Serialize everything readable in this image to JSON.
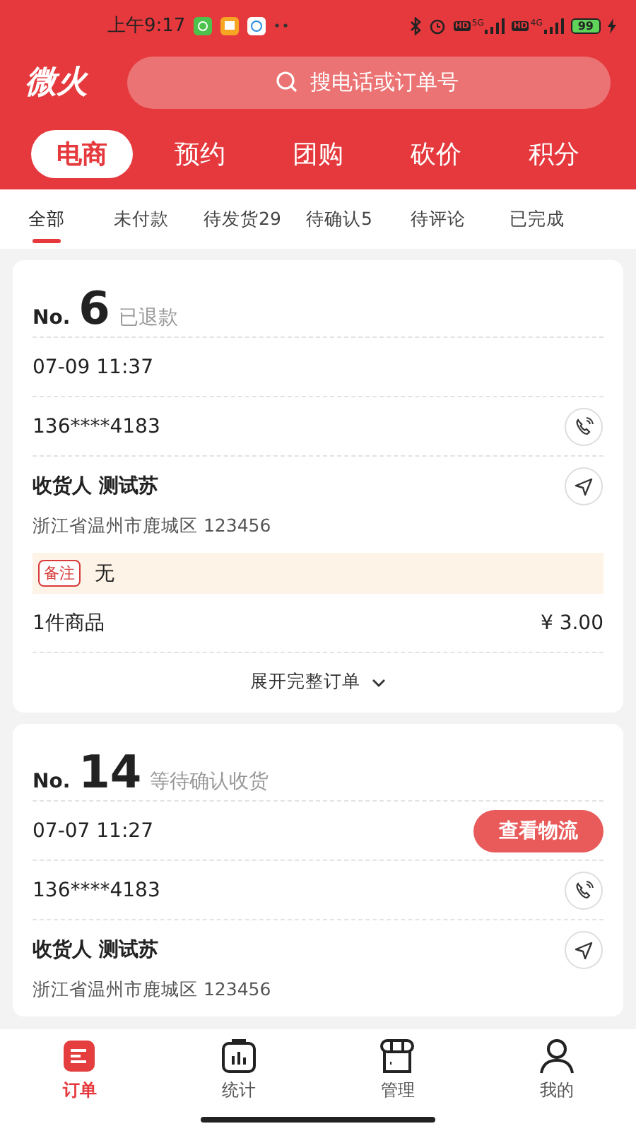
{
  "status_bar": {
    "time": "上午9:17",
    "signals": [
      {
        "badge": "HD",
        "network": "5G"
      },
      {
        "badge": "HD",
        "network": "4G"
      }
    ],
    "battery": "99"
  },
  "header": {
    "logo": "微火",
    "search": {
      "placeholder": "搜电话或订单号"
    }
  },
  "business_tabs": [
    {
      "label": "电商",
      "selected": true
    },
    {
      "label": "预约",
      "selected": false
    },
    {
      "label": "团购",
      "selected": false
    },
    {
      "label": "砍价",
      "selected": false
    },
    {
      "label": "积分",
      "selected": false
    }
  ],
  "status_tabs": [
    {
      "label": "全部",
      "selected": true
    },
    {
      "label": "未付款",
      "selected": false
    },
    {
      "label": "待发货29",
      "selected": false
    },
    {
      "label": "待确认5",
      "selected": false
    },
    {
      "label": "待评论",
      "selected": false
    },
    {
      "label": "已完成",
      "selected": false
    }
  ],
  "orders": [
    {
      "no_label": "No.",
      "number": "6",
      "status": "已退款",
      "time": "07-09 11:37",
      "phone": "136****4183",
      "receiver": "收货人 测试苏",
      "address": "浙江省温州市鹿城区 123456",
      "remark_label": "备注",
      "remark": "无",
      "items": "1件商品",
      "total": "¥ 3.00",
      "expand": "展开完整订单"
    },
    {
      "no_label": "No.",
      "number": "14",
      "status": "等待确认收货",
      "time": "07-07 11:27",
      "action": "查看物流",
      "phone": "136****4183",
      "receiver": "收货人 测试苏",
      "address": "浙江省温州市鹿城区 123456"
    }
  ],
  "bottom_nav": [
    {
      "kind": "orders",
      "label": "订单",
      "selected": true
    },
    {
      "kind": "stats",
      "label": "统计",
      "selected": false
    },
    {
      "kind": "shop",
      "label": "管理",
      "selected": false
    },
    {
      "kind": "user",
      "label": "我的",
      "selected": false
    }
  ]
}
